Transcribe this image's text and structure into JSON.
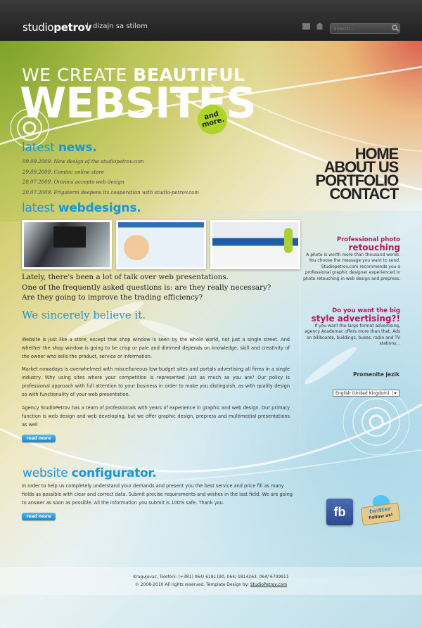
{
  "header": {
    "logo_light": "studio",
    "logo_bold": "petrov",
    "tagline": "dizajn sa stilom",
    "search_placeholder": "Search..."
  },
  "hero": {
    "line1_light": "WE CREATE",
    "line1_bold": "BEAUTIFUL",
    "line2": "WEBSITES",
    "badge_line1": "and",
    "badge_line2": "more."
  },
  "news": {
    "heading_light": "latest",
    "heading_bold": "news.",
    "items": [
      "09.09.2009. New design of the studiopetrov.com",
      "29.09.2009. Comtec online store",
      "28.07.2009. Oranica accepts web design",
      "20.07.2009. Frigoterm deepens its cooperation with studio-petrov.com"
    ]
  },
  "webdesigns": {
    "heading_light": "latest",
    "heading_bold": "webdesigns."
  },
  "intro": {
    "lead1": "Lately, there's been a lot of talk over web presentations.",
    "lead2": "One of the frequently asked questions is: are they really necessary?",
    "lead3": "Are they going to improve the trading efficiency?",
    "believe": "We sincerely believe it.",
    "para1": "Website is just like a store, except that shop window is seen by the whole world, not just a single street. And whether the shop window is going to be crisp or pale and dimmed depends on knowledge, skill and creativity of the owner who sells the product, service or information.",
    "para2": "Market nowadays is overwhelmed with miscellaneous low-budget sites and portals advertising all firms in a single industry. Why using sites where your competition is represented just as much as you are? Our policy is professional approach with full attention to your business in order to make you distinguish, as with quality design so with functionality of your web presentation.",
    "para3": "Agency StudioPetrov has a team of professionals with years of experience in graphic and web design. Our primary function is web design and web developing, but we offer graphic design, prepress and multimedial presentations as well",
    "read_more": "read more"
  },
  "configurator": {
    "heading_light": "website",
    "heading_bold": "configurator.",
    "text": "In order to help us completely understand your demands and present you the best service and price fill as many fields as possible with clear and correct data. Submit precise requirements and wishes in the last field. We are going to answer as soon as possible. All the information you submit is 100% safe. Thank you.",
    "read_more": "read more"
  },
  "nav": {
    "items": [
      "HOME",
      "ABOUT US",
      "PORTFOLIO",
      "CONTACT"
    ]
  },
  "promo_retouching": {
    "title1": "Professional photo",
    "title2": "retouching",
    "body": "A photo is worth more than thousand words. You choose the message you want to send. Studiopetrov.com recommends you a professional graphic designer experienced in photo retouching in web design and prepress."
  },
  "promo_advertising": {
    "title1": "Do you want the big",
    "title2": "style advertising?!",
    "body": "If you want the large format advertising, agency Academac offers more than that. Ads on billboards, buildings, buses, radio and TV stations..."
  },
  "language": {
    "label": "Promenite jezik",
    "selected": "English (United Kingdom)"
  },
  "social": {
    "facebook": "fb",
    "twitter_word": "twitter",
    "twitter_follow": "Follow us!"
  },
  "footer": {
    "contact": "Kragujevac, Telefoni: (+381) 064/ 6181190, 064/ 1814263, 064/ 6709911",
    "copyright": "© 2008-2010 All rights reserved. Template Design by: ",
    "designer_link": "StudioPetrov.com"
  }
}
